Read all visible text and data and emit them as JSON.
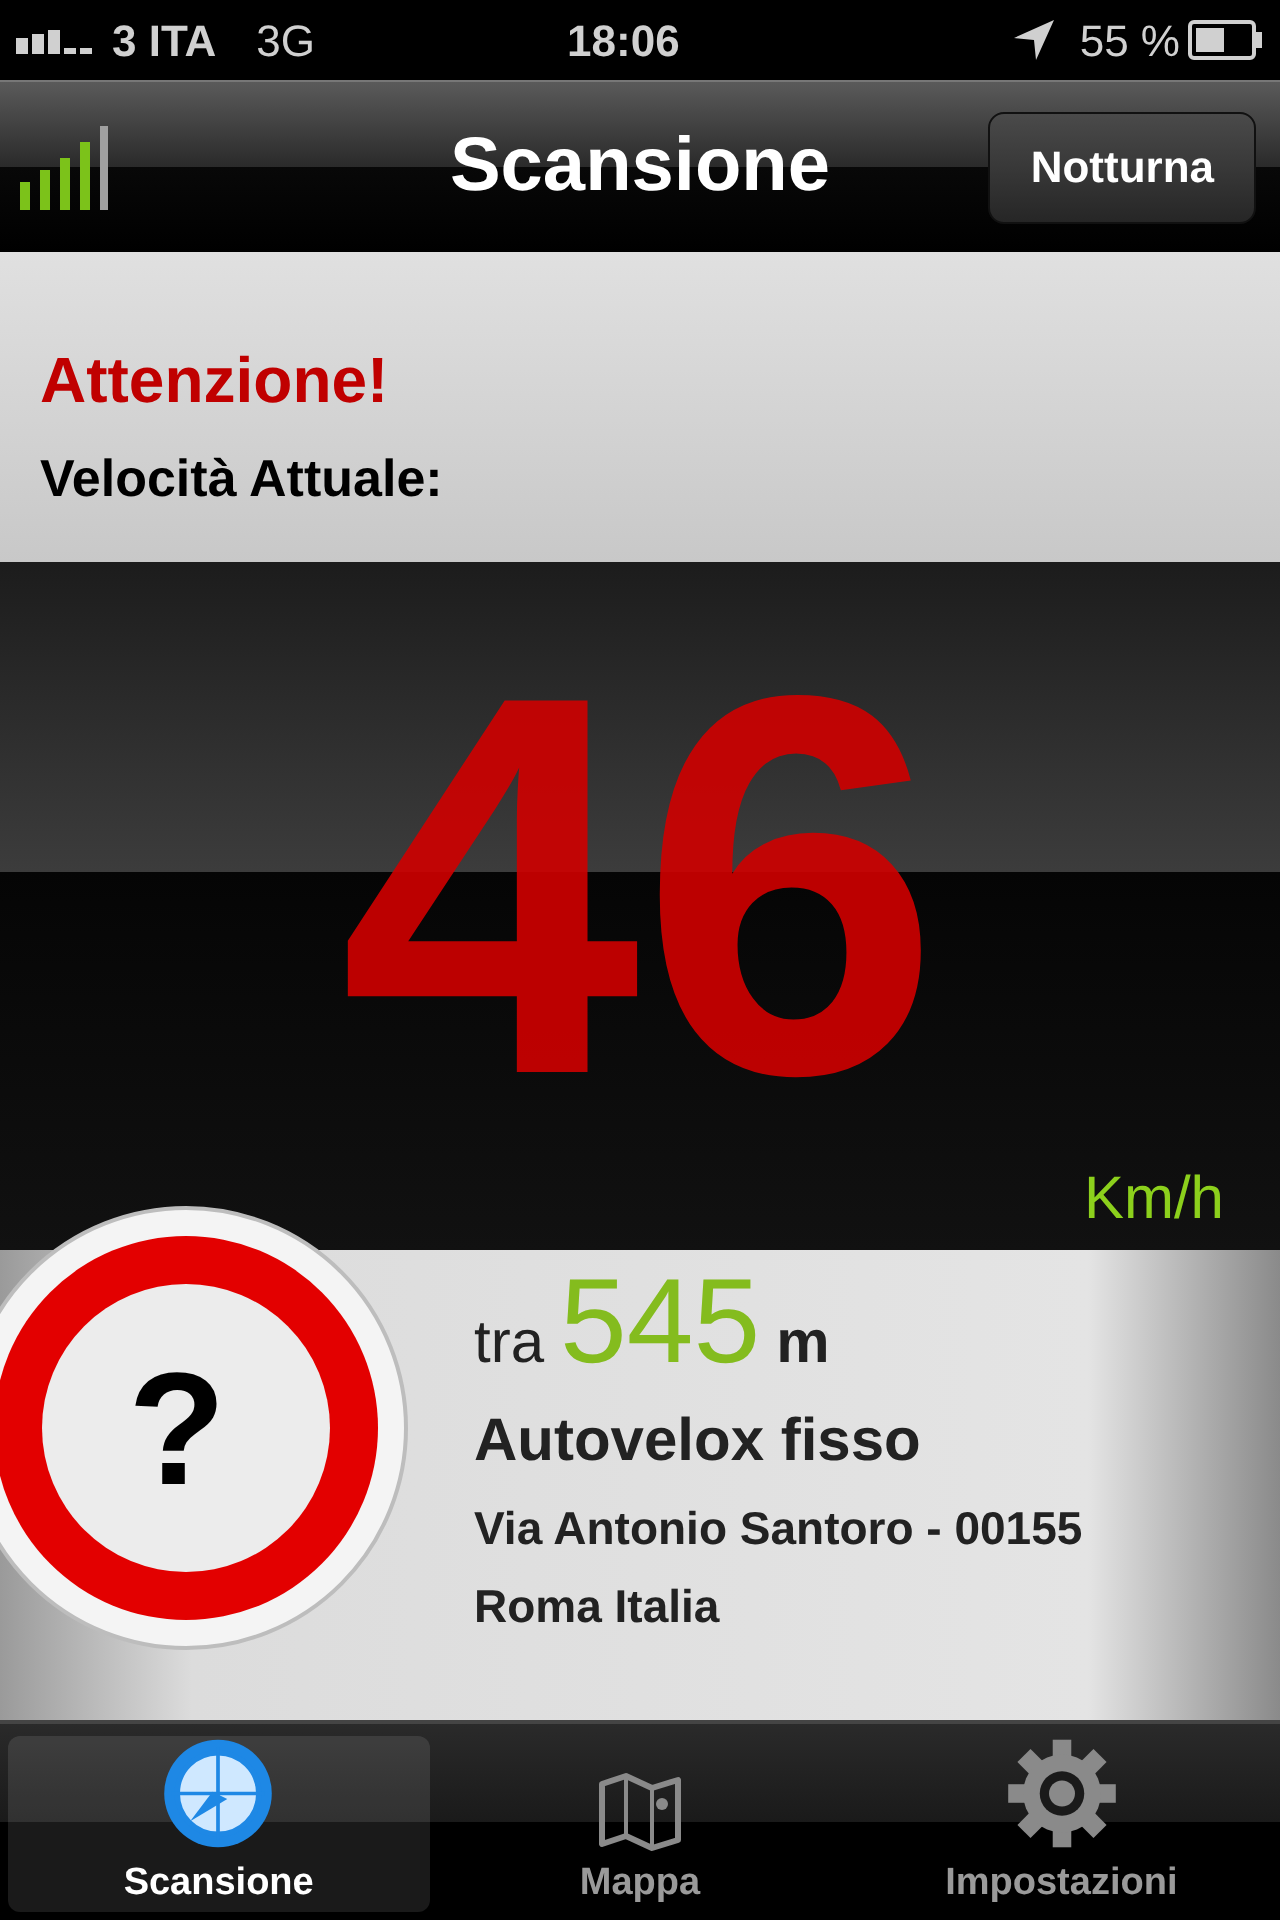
{
  "status_bar": {
    "carrier": "3 ITA",
    "network": "3G",
    "time": "18:06",
    "battery": "55 %"
  },
  "nav_bar": {
    "title": "Scansione",
    "button": "Notturna"
  },
  "alert": {
    "title": "Attenzione!",
    "label": "Velocità Attuale:"
  },
  "speed": {
    "value": "46",
    "unit": "Km/h"
  },
  "camera": {
    "sign": "?",
    "prefix": "tra",
    "distance": "545",
    "distance_unit": "m",
    "type": "Autovelox fisso",
    "address_line_1": "Via Antonio Santoro - 00155",
    "address_line_2": "Roma Italia"
  },
  "tab_bar": [
    {
      "label": "Scansione",
      "kind": "radar",
      "selected": true
    },
    {
      "label": "Mappa",
      "kind": "map",
      "selected": false
    },
    {
      "label": "Impostazioni",
      "kind": "gear",
      "selected": false
    }
  ]
}
